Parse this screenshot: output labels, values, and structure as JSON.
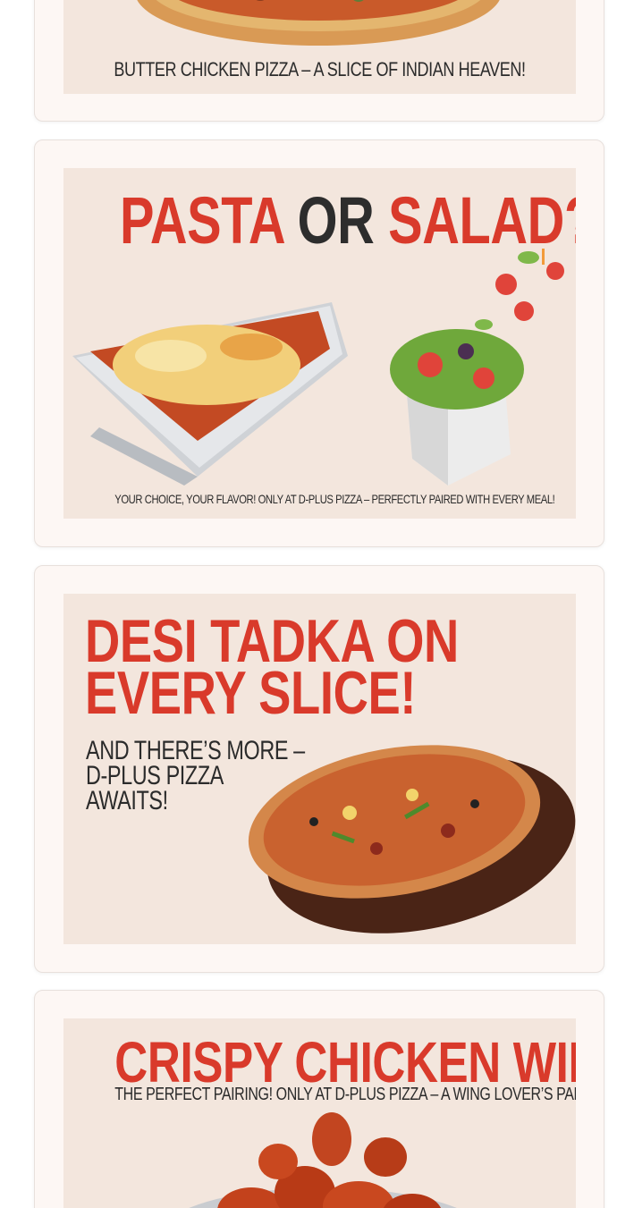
{
  "posts": [
    {
      "caption": "BUTTER CHICKEN PIZZA – A SLICE OF INDIAN HEAVEN!"
    },
    {
      "headline_part1": "PASTA",
      "headline_part2": "OR",
      "headline_part3": "SALAD?",
      "caption": "YOUR CHOICE, YOUR FLAVOR! ONLY AT D-PLUS PIZZA – PERFECTLY PAIRED WITH EVERY MEAL!"
    },
    {
      "headline_line1": "DESI TADKA ON",
      "headline_line2": "EVERY SLICE!",
      "sub_line1": "AND THERE’S MORE –",
      "sub_line2": "D-PLUS PIZZA",
      "sub_line3": "AWAITS!"
    },
    {
      "headline": "CRISPY CHICKEN WINGS",
      "caption": "THE PERFECT PAIRING! ONLY AT D-PLUS PIZZA – A WING LOVER’S PARADISE!"
    }
  ],
  "icons": {
    "butter_chicken_pizza": "pizza-image",
    "lasagna": "lasagna-tray-image",
    "salad": "salad-box-image",
    "desi_pizza": "pizza-on-board-image",
    "wings": "chicken-wings-image"
  },
  "colors": {
    "accent_red": "#d93a2b",
    "poster_bg": "#f3e6dd",
    "card_bg": "#fdf7f4",
    "text_dark": "#2b2b2b"
  }
}
